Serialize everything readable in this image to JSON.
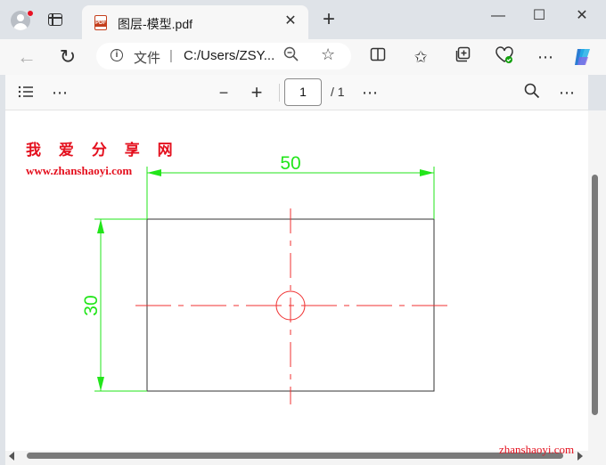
{
  "tab": {
    "title": "图层-模型.pdf",
    "file_badge": "PDF"
  },
  "address": {
    "protocol_label": "文件",
    "separator": "|",
    "url": "C:/Users/ZSY..."
  },
  "pdf_toolbar": {
    "page_current": "1",
    "page_total": "/ 1",
    "minus": "−",
    "plus": "+"
  },
  "document": {
    "watermark_title": "我 爱 分 享 网",
    "watermark_url": "www.zhanshaoyi.com",
    "dimension_width": "50",
    "dimension_height": "30"
  },
  "footer_watermark": "zhanshaoyi.com",
  "colors": {
    "dimension": "#22e51a",
    "centerline": "#f03030",
    "outline": "#333333",
    "watermark": "#e4101e"
  }
}
